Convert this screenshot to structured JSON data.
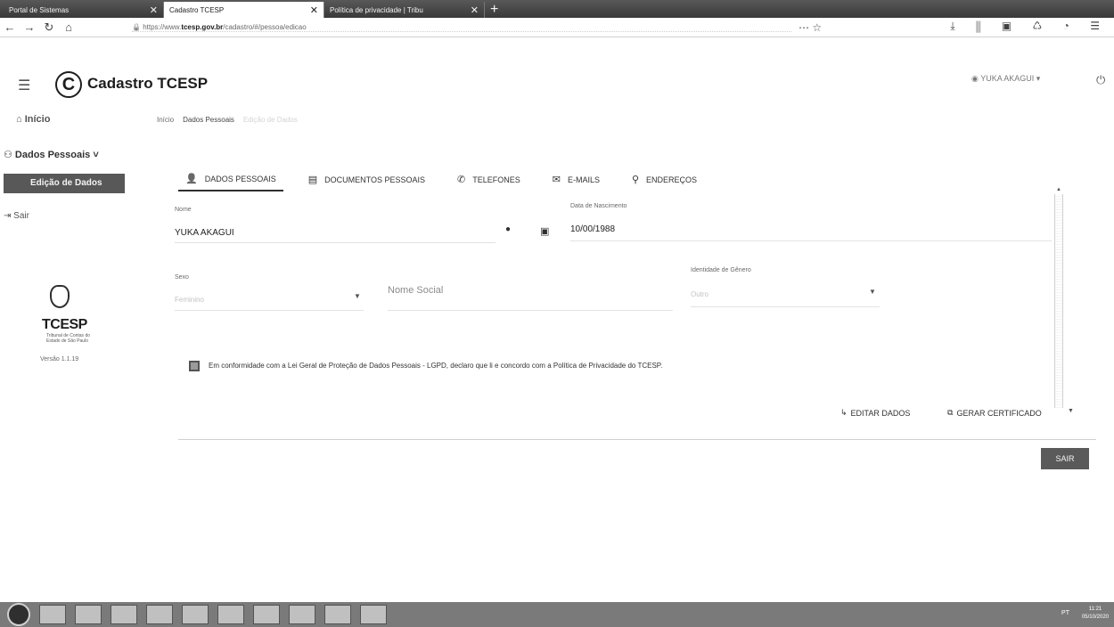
{
  "browser": {
    "tabs": [
      {
        "title": "Portal de Sistemas"
      },
      {
        "title": "Cadastro TCESP"
      },
      {
        "title": "Política de privacidade | Tribu"
      }
    ],
    "url_prefix": "https://www.",
    "url_domain": "tcesp.gov.br",
    "url_path": "/cadastro/#/pessoa/edicao"
  },
  "app": {
    "title": "Cadastro TCESP",
    "user_label": "YUKA AKAGUI ▾"
  },
  "sidebar": {
    "inicio": "Início",
    "dados_pessoais": "Dados Pessoais",
    "edicao": "Edição de Dados",
    "sair": "Sair",
    "logo_text": "TCESP",
    "logo_sub": "Tribunal de Contas do Estado de São Paulo",
    "version": "Versão 1.1.19"
  },
  "breadcrumb": {
    "items": [
      "Início",
      "Dados Pessoais",
      "Edição de Dados"
    ]
  },
  "tabs": [
    {
      "label": "DADOS PESSOAIS",
      "icon": "person-icon"
    },
    {
      "label": "DOCUMENTOS PESSOAIS",
      "icon": "document-icon"
    },
    {
      "label": "TELEFONES",
      "icon": "phone-icon"
    },
    {
      "label": "E-MAILS",
      "icon": "mail-icon"
    },
    {
      "label": "ENDEREÇOS",
      "icon": "location-icon"
    }
  ],
  "form": {
    "nome_label": "Nome",
    "nome_value": "YUKA AKAGUI",
    "nascimento_label": "Data de Nascimento",
    "nascimento_value": "10/00/1988",
    "sexo_label": "Sexo",
    "sexo_value": "Feminino",
    "nome_social_placeholder": "Nome Social",
    "genero_label": "Identidade de Gênero",
    "genero_value": "Outro"
  },
  "consent": {
    "text": "Em conformidade com a Lei Geral de Proteção de Dados Pessoais - LGPD, declaro que li e concordo com a Política de Privacidade do TCESP."
  },
  "actions": {
    "edit": "EDITAR DADOS",
    "cert": "GERAR CERTIFICADO",
    "sair": "SAIR"
  },
  "taskbar": {
    "tray": "PT",
    "time": "11:21",
    "date": "05/10/2020"
  }
}
